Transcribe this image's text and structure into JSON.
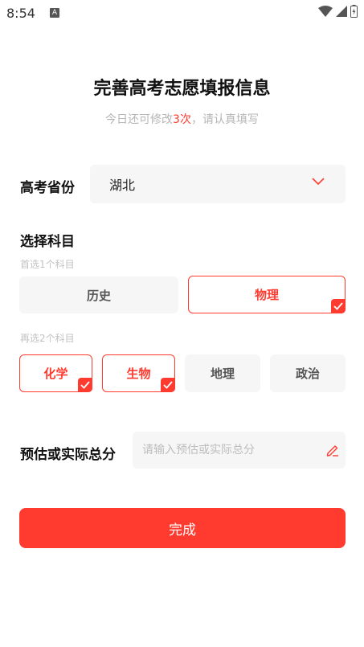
{
  "status_bar": {
    "time": "8:54",
    "badge": "A"
  },
  "header": {
    "title": "完善高考志愿填报信息",
    "subtitle_prefix": "今日还可修改",
    "subtitle_count": "3次",
    "subtitle_suffix": "，请认真填写"
  },
  "province": {
    "label": "高考省份",
    "value": "湖北"
  },
  "subjects": {
    "label": "选择科目",
    "first_hint": "首选1个科目",
    "first": [
      {
        "label": "历史",
        "selected": false
      },
      {
        "label": "物理",
        "selected": true
      }
    ],
    "second_hint": "再选2个科目",
    "second": [
      {
        "label": "化学",
        "selected": true
      },
      {
        "label": "生物",
        "selected": true
      },
      {
        "label": "地理",
        "selected": false
      },
      {
        "label": "政治",
        "selected": false
      }
    ]
  },
  "score": {
    "label": "预估或实际总分",
    "placeholder": "请输入预估或实际总分",
    "value": ""
  },
  "finish_label": "完成",
  "colors": {
    "accent": "#ff3b30",
    "field_bg": "#f6f6f6"
  }
}
